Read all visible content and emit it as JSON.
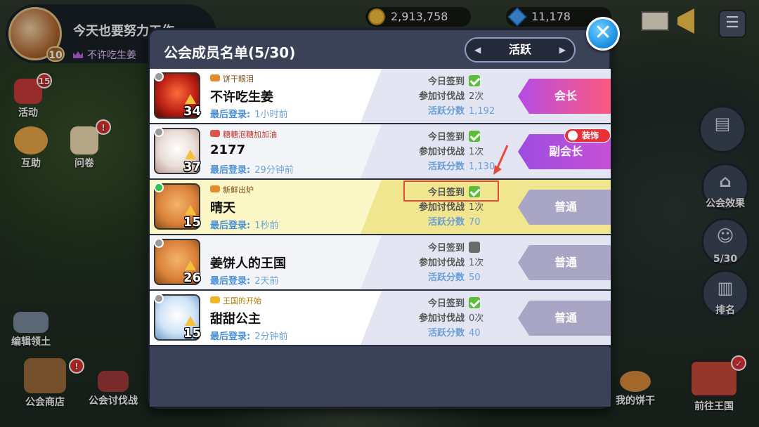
{
  "profile": {
    "name": "今天也要努力工作",
    "level": "10",
    "guild": "不许吃生姜"
  },
  "resources": {
    "coins": "2,913,758",
    "gems": "11,178"
  },
  "left_buttons": {
    "events": "活动",
    "events_badge": "15",
    "help": "互助",
    "survey": "问卷",
    "edit_land": "编辑领土",
    "guild_shop": "公会商店",
    "guild_raid": "公会讨伐战"
  },
  "right_buttons": {
    "guild_effect": "公会效果",
    "members": "5/30",
    "ranking": "排名"
  },
  "bottom_buttons": {
    "my_cookie": "我的饼干",
    "go_kingdom": "前往王国"
  },
  "modal": {
    "title": "公会成员名单(5/30)",
    "filter": "活跃",
    "stat_labels": {
      "checkin": "今日签到",
      "raid": "参加讨伐战",
      "activity": "活跃分数"
    },
    "login_label": "最后登录:"
  },
  "members": [
    {
      "title": "饼干眼泪",
      "name": "不许吃生姜",
      "level": "34",
      "last_login": "1小时前",
      "checked_in": true,
      "raid": "2次",
      "activity": "1,192",
      "role": "会长",
      "online": false
    },
    {
      "title": "糖糖泡糖加加油",
      "name": "2177",
      "level": "37",
      "last_login": "29分钟前",
      "checked_in": true,
      "raid": "1次",
      "activity": "1,130",
      "role": "副会长",
      "online": false,
      "badge": "装饰"
    },
    {
      "title": "新鲜出炉",
      "name": "晴天",
      "level": "15",
      "last_login": "1秒前",
      "checked_in": true,
      "raid": "1次",
      "activity": "70",
      "role": "普通",
      "online": true
    },
    {
      "title": "",
      "name": "姜饼人的王国",
      "level": "26",
      "last_login": "2天前",
      "checked_in": false,
      "raid": "1次",
      "activity": "50",
      "role": "普通",
      "online": false
    },
    {
      "title": "王国的开始",
      "name": "甜甜公主",
      "level": "15",
      "last_login": "2分钟前",
      "checked_in": true,
      "raid": "0次",
      "activity": "40",
      "role": "普通",
      "online": false
    }
  ],
  "colors": {
    "accent_blue": "#1a8ae0",
    "check_green": "#5bbd3a",
    "leader_gradient": "#b54ce6",
    "highlight_red": "#e54a3b"
  },
  "icons": {
    "close": "close-icon",
    "checkin_yes": "check-icon",
    "checkin_no": "empty-checkbox-icon"
  }
}
